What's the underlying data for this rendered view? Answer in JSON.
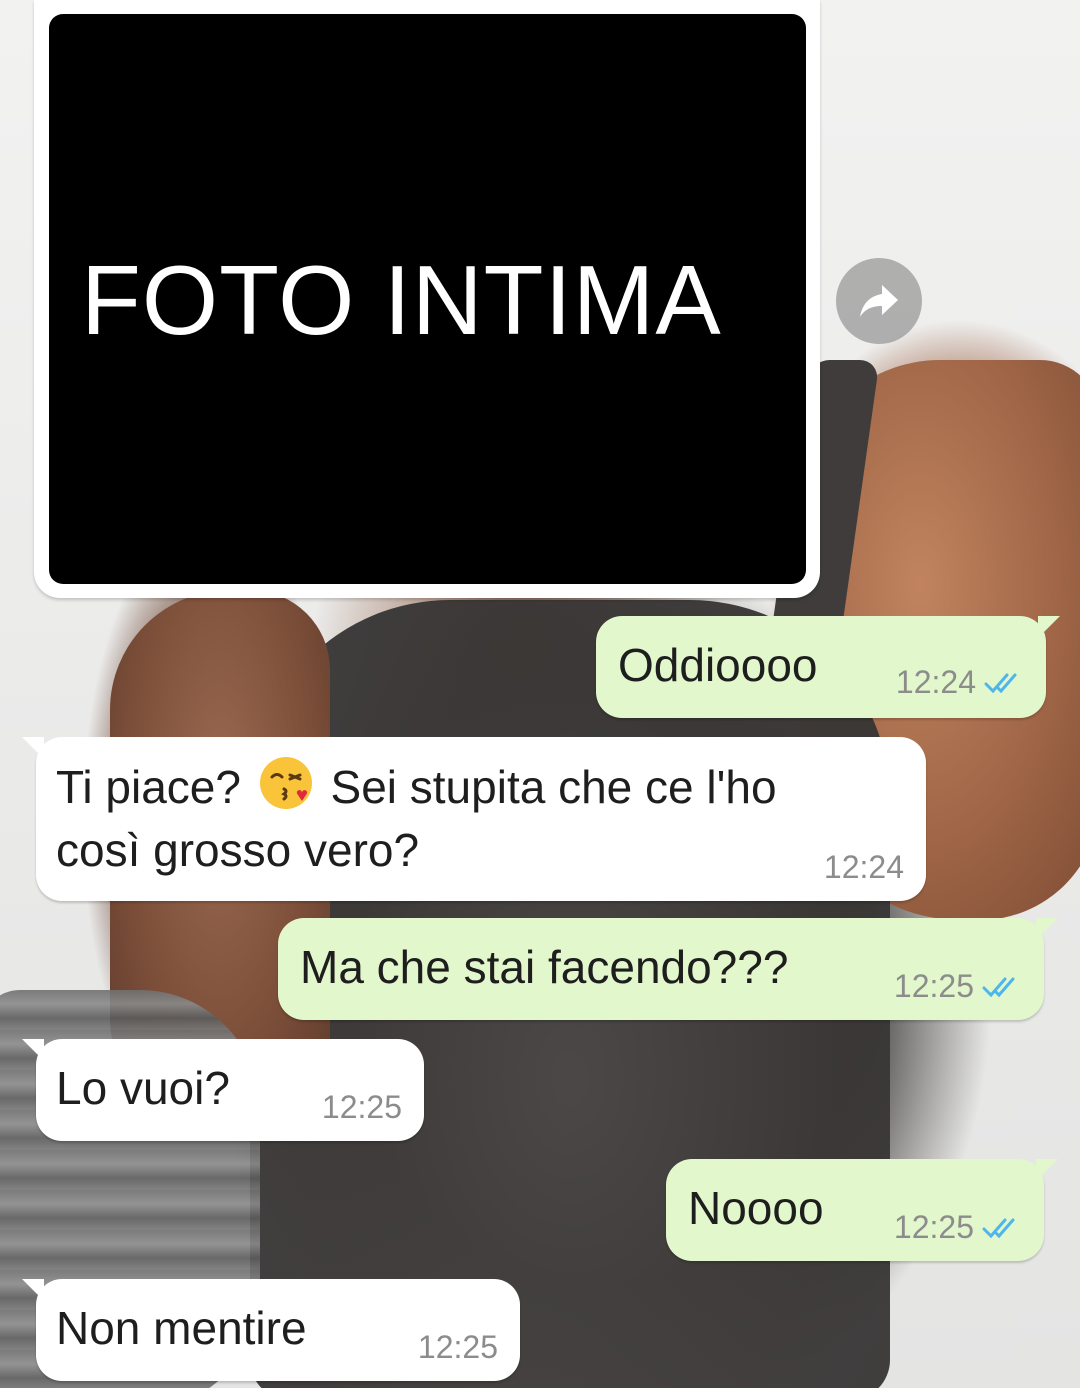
{
  "photo_message": {
    "caption": "FOTO INTIMA",
    "forward_icon": "forward-arrow-icon"
  },
  "messages": [
    {
      "direction": "outgoing",
      "text": "Oddioooo",
      "time": "12:24",
      "status": "read"
    },
    {
      "direction": "incoming",
      "text_before_emoji": "Ti piace?",
      "emoji": "kissing-face-with-heart",
      "text_after_emoji": "Sei stupita che ce l'ho",
      "text_line2": "così grosso vero?",
      "time": "12:24"
    },
    {
      "direction": "outgoing",
      "text": "Ma che stai facendo???",
      "time": "12:25",
      "status": "read"
    },
    {
      "direction": "incoming",
      "text": "Lo vuoi?",
      "time": "12:25"
    },
    {
      "direction": "outgoing",
      "text": "Noooo",
      "time": "12:25",
      "status": "read"
    },
    {
      "direction": "incoming",
      "text": "Non mentire",
      "time": "12:25"
    }
  ],
  "colors": {
    "incoming_bubble": "#ffffff",
    "outgoing_bubble": "#e2f7cb",
    "read_ticks": "#4fb6ec",
    "time_text": "#8c8c8c"
  }
}
